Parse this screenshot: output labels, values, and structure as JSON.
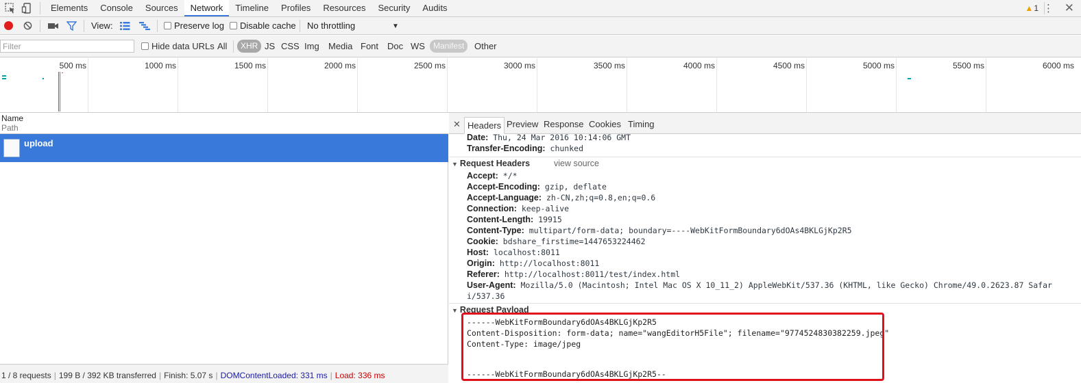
{
  "tabbar": {
    "tabs": [
      "Elements",
      "Console",
      "Sources",
      "Network",
      "Timeline",
      "Profiles",
      "Resources",
      "Security",
      "Audits"
    ],
    "active_tab": "Network",
    "warning_count": "1",
    "menu_glyph": "⋮",
    "close_glyph": "✕"
  },
  "toolbar": {
    "view_label": "View:",
    "preserve_log": "Preserve log",
    "disable_cache": "Disable cache",
    "throttling": "No throttling"
  },
  "filterbar": {
    "placeholder": "Filter",
    "hide_data_urls": "Hide data URLs",
    "types": [
      "All",
      "XHR",
      "JS",
      "CSS",
      "Img",
      "Media",
      "Font",
      "Doc",
      "WS",
      "Manifest",
      "Other"
    ],
    "selected_type": "XHR"
  },
  "timeline": {
    "ticks": [
      "500 ms",
      "1000 ms",
      "1500 ms",
      "2000 ms",
      "2500 ms",
      "3000 ms",
      "3500 ms",
      "4000 ms",
      "4500 ms",
      "5000 ms",
      "5500 ms",
      "6000 ms"
    ]
  },
  "request_list": {
    "name_header": "Name",
    "path_header": "Path",
    "requests": [
      {
        "name": "upload"
      }
    ]
  },
  "status": {
    "requests": "1 / 8 requests",
    "transferred": "199 B / 392 KB transferred",
    "finish": "Finish: 5.07 s",
    "dom_content_loaded": "DOMContentLoaded: 331 ms",
    "load": "Load: 336 ms"
  },
  "details": {
    "tabs": [
      "Headers",
      "Preview",
      "Response",
      "Cookies",
      "Timing"
    ],
    "active_tab": "Headers",
    "response_headers_tail": [
      {
        "k": "Date:",
        "v": "Thu, 24 Mar 2016 10:14:06 GMT"
      },
      {
        "k": "Transfer-Encoding:",
        "v": "chunked"
      }
    ],
    "request_headers_title": "Request Headers",
    "view_source": "view source",
    "request_headers": [
      {
        "k": "Accept:",
        "v": "*/*"
      },
      {
        "k": "Accept-Encoding:",
        "v": "gzip, deflate"
      },
      {
        "k": "Accept-Language:",
        "v": "zh-CN,zh;q=0.8,en;q=0.6"
      },
      {
        "k": "Connection:",
        "v": "keep-alive"
      },
      {
        "k": "Content-Length:",
        "v": "19915"
      },
      {
        "k": "Content-Type:",
        "v": "multipart/form-data; boundary=----WebKitFormBoundary6dOAs4BKLGjKp2R5"
      },
      {
        "k": "Cookie:",
        "v": "bdshare_firstime=1447653224462"
      },
      {
        "k": "Host:",
        "v": "localhost:8011"
      },
      {
        "k": "Origin:",
        "v": "http://localhost:8011"
      },
      {
        "k": "Referer:",
        "v": "http://localhost:8011/test/index.html"
      },
      {
        "k": "User-Agent:",
        "v": "Mozilla/5.0 (Macintosh; Intel Mac OS X 10_11_2) AppleWebKit/537.36 (KHTML, like Gecko) Chrome/49.0.2623.87 Safar"
      }
    ],
    "user_agent_wrap": "i/537.36",
    "request_payload_title": "Request Payload",
    "payload_lines": [
      "------WebKitFormBoundary6dOAs4BKLGjKp2R5",
      "Content-Disposition: form-data; name=\"wangEditorH5File\"; filename=\"9774524830382259.jpeg\"",
      "Content-Type: image/jpeg",
      "",
      "",
      "------WebKitFormBoundary6dOAs4BKLGjKp2R5--"
    ]
  }
}
